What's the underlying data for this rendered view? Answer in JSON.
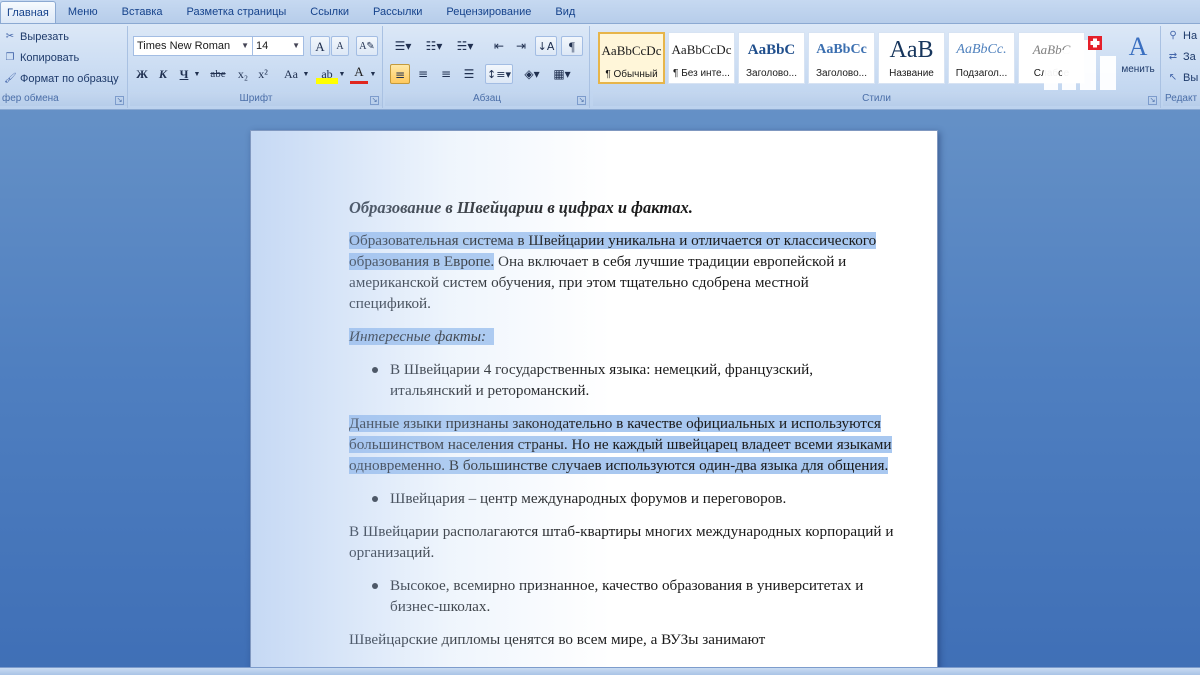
{
  "tabs": [
    "Главная",
    "Меню",
    "Вставка",
    "Разметка страницы",
    "Ссылки",
    "Рассылки",
    "Рецензирование",
    "Вид"
  ],
  "clipboard": {
    "cut": "Вырезать",
    "copy": "Копировать",
    "format_painter": "Формат по образцу",
    "group_label": "фер обмена"
  },
  "font": {
    "name": "Times New Roman",
    "size": "14",
    "group_label": "Шрифт",
    "bold": "Ж",
    "italic": "К",
    "underline": "Ч",
    "strike": "abe",
    "subscript": "x₂",
    "superscript": "x²",
    "case": "Aa",
    "grow": "A",
    "shrink": "A"
  },
  "paragraph": {
    "group_label": "Абзац"
  },
  "styles": {
    "group_label": "Стили",
    "items": [
      {
        "sample": "AaBbCcDc",
        "name": "¶ Обычный"
      },
      {
        "sample": "AaBbCcDc",
        "name": "¶ Без инте..."
      },
      {
        "sample": "AaBbC",
        "name": "Заголово..."
      },
      {
        "sample": "AaBbCc",
        "name": "Заголово..."
      },
      {
        "sample": "AaB",
        "name": "Название"
      },
      {
        "sample": "AaBbCc.",
        "name": "Подзагол..."
      },
      {
        "sample": "AaBbC",
        "name": "Слабое"
      }
    ],
    "change_styles": "менить"
  },
  "editing": {
    "group_label": "Редакт",
    "find": "На",
    "replace": "За",
    "select": "Вы"
  },
  "document": {
    "title": "Образование в Швейцарии в цифрах и фактах.",
    "p1_selected": "Образовательная система в Швейцарии уникальна и отличается от классического образования в Европе.",
    "p1_rest": " Она включает в себя лучшие традиции европейской и американской систем обучения, при этом тщательно сдобрена местной спецификой.",
    "facts_heading": "Интересные факты:",
    "bullet1": "В Швейцарии 4 государственных языка: немецкий, французский, итальянский и ретороманский.",
    "p2_selected": "Данные языки признаны законодательно в качестве официальных и используются большинством населения страны. Но не каждый швейцарец владеет всеми языками одновременно. В большинстве случаев используются один-два языка для общения.",
    "bullet2": "Швейцария – центр международных форумов и переговоров.",
    "p3": " В Швейцарии располагаются штаб-квартиры многих международных корпораций и организаций.",
    "bullet3": "Высокое, всемирно признанное, качество образования в университетах и бизнес-школах.",
    "p4_partial": "Швейцарские дипломы ценятся во всем мире, а ВУЗы занимают"
  },
  "colors": {
    "selection": "#a9c8f0",
    "ribbon": "#c9dbf2",
    "background": "#4f7fc0"
  }
}
